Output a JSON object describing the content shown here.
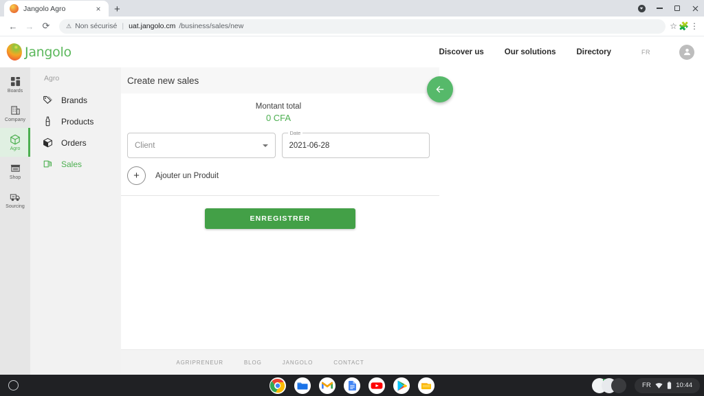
{
  "browser": {
    "tab": {
      "title": "Jangolo Agro",
      "favicon": "mango-icon",
      "close": "×"
    },
    "new_tab_label": "+",
    "window_controls": {
      "minimize": "–",
      "maximize": "□",
      "close": "×",
      "cast": "cast-icon"
    },
    "nav": {
      "back": "←",
      "forward": "→",
      "reload": "⟳"
    },
    "omnibox": {
      "security_text": "Non sécurisé",
      "security_icon": "warning-triangle-icon",
      "url_host": "uat.jangolo.cm",
      "url_path": "/business/sales/new",
      "star_icon": "bookmark-star-icon",
      "extensions_icon": "puzzle-piece-icon",
      "menu_icon": "three-dot-menu-icon"
    }
  },
  "site_header": {
    "logo_text": "angolo",
    "logo_initial": "J",
    "nav_links": [
      "Discover us",
      "Our solutions",
      "Directory"
    ],
    "language": "FR",
    "account_icon": "account-circle-icon"
  },
  "rail": {
    "items": [
      {
        "label": "Boards",
        "icon": "dashboard-grid-icon",
        "active": false
      },
      {
        "label": "Company",
        "icon": "building-icon",
        "active": false
      },
      {
        "label": "Agro",
        "icon": "box-cube-icon",
        "active": true
      },
      {
        "label": "Shop",
        "icon": "storefront-icon",
        "active": false
      },
      {
        "label": "Sourcing",
        "icon": "delivery-truck-icon",
        "active": false
      }
    ]
  },
  "subnav": {
    "title": "Agro",
    "items": [
      {
        "label": "Brands",
        "icon": "tags-icon",
        "active": false
      },
      {
        "label": "Products",
        "icon": "bottle-icon",
        "active": false
      },
      {
        "label": "Orders",
        "icon": "package-box-icon",
        "active": false
      },
      {
        "label": "Sales",
        "icon": "banknotes-icon",
        "active": true
      }
    ]
  },
  "main": {
    "card_title": "Create new sales",
    "back_fab_icon": "arrow-left-icon",
    "total_label": "Montant total",
    "total_value": "0 CFA",
    "client_field": {
      "placeholder": "Client",
      "value": ""
    },
    "date_field": {
      "legend": "Date",
      "value": "2021-06-28"
    },
    "add_product": {
      "button": "+",
      "label": "Ajouter un Produit"
    },
    "save_button": "ENREGISTRER"
  },
  "footer": {
    "links": [
      "AGRIPRENEUR",
      "BLOG",
      "JANGOLO",
      "CONTACT"
    ]
  },
  "shelf": {
    "launcher_icon": "launcher-circle-icon",
    "apps": [
      {
        "name": "chrome-icon",
        "running": true
      },
      {
        "name": "files-icon",
        "running": false
      },
      {
        "name": "gmail-icon",
        "running": true
      },
      {
        "name": "docs-icon",
        "running": false
      },
      {
        "name": "youtube-icon",
        "running": true
      },
      {
        "name": "play-store-icon",
        "running": false
      },
      {
        "name": "keep-icon",
        "running": false
      }
    ],
    "tray": {
      "language": "FR",
      "wifi_icon": "wifi-icon",
      "battery_icon": "battery-icon",
      "time": "10:44"
    }
  },
  "colors": {
    "brand_green": "#4caf50",
    "save_green": "#43a047",
    "fab_green": "#56b96a"
  }
}
